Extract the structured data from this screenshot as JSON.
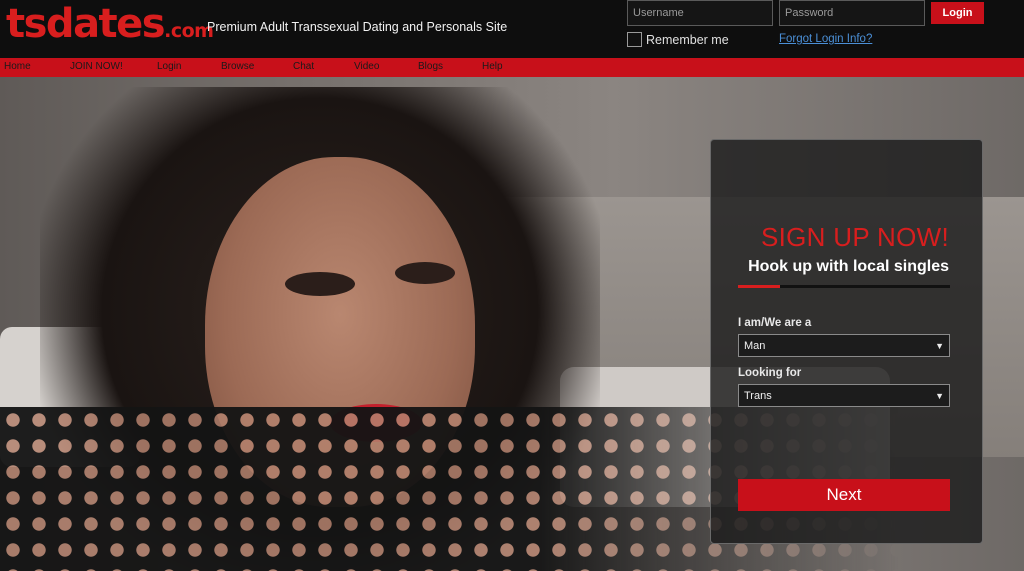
{
  "header": {
    "logo_main": "tsdates",
    "logo_tld": ".com",
    "tagline": "Premium Adult Transsexual Dating and Personals Site",
    "username_placeholder": "Username",
    "password_placeholder": "Password",
    "login_label": "Login",
    "remember_label": "Remember me",
    "forgot_label": "Forgot Login Info?"
  },
  "nav": {
    "items": [
      {
        "label": "Home"
      },
      {
        "label": "JOIN NOW!"
      },
      {
        "label": "Login"
      },
      {
        "label": "Browse"
      },
      {
        "label": "Chat"
      },
      {
        "label": "Video"
      },
      {
        "label": "Blogs"
      },
      {
        "label": "Help"
      }
    ]
  },
  "signup": {
    "title": "SIGN UP NOW!",
    "subtitle": "Hook up with local singles",
    "iam_label": "I am/We are a",
    "iam_value": "Man",
    "looking_label": "Looking for",
    "looking_value": "Trans",
    "next_label": "Next"
  },
  "colors": {
    "brand_red": "#c8101a",
    "link_blue": "#4b8fd6"
  }
}
